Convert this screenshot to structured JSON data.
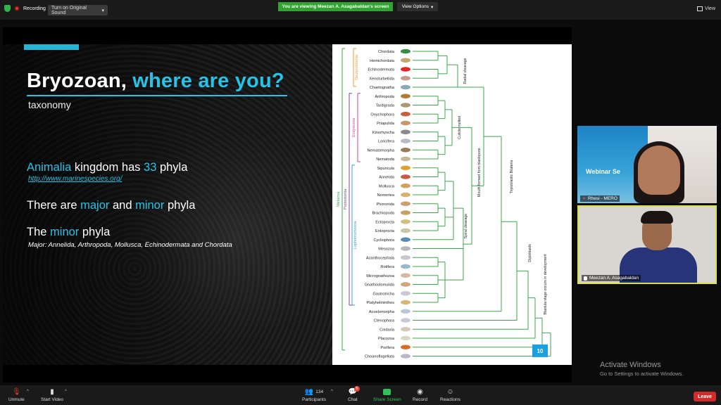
{
  "topbar": {
    "recording_label": "Recording",
    "sound_button": "Turn on Original Sound",
    "viewing_banner": "You are viewing Meezan A. Asagabaldan's screen",
    "view_options": "View Options",
    "view_label": "View"
  },
  "slide": {
    "title_part1": "Bryozoan, ",
    "title_part2": "where are you?",
    "subtitle": "taxonomy",
    "l1_a": "Animalia",
    "l1_b": " kingdom has ",
    "l1_c": "33",
    "l1_d": " phyla",
    "link": "http://www.marinespecies.org/",
    "l2_a": "There are ",
    "l2_b": "major",
    "l2_c": " and ",
    "l2_d": "minor",
    "l2_e": " phyla",
    "l3_a": "The ",
    "l3_b": "minor",
    "l3_c": " phyla",
    "major_note": "Major: Annelida, Arthropoda, Mollusca, Echinodermata and Chordata"
  },
  "tree": {
    "taxa": [
      "Chordata",
      "Hemichordata",
      "Echinodermata",
      "Xenoturbellida",
      "Chaetognatha",
      "Arthropoda",
      "Tardigrada",
      "Onychophora",
      "Priapulida",
      "Kinorhyncha",
      "Loricifera",
      "Nematomorpha",
      "Nematoda",
      "Sipuncula",
      "Annelida",
      "Mollusca",
      "Nemertea",
      "Phoronida",
      "Brachiopoda",
      "Ectoprocta",
      "Entoprocta",
      "Cycliophora",
      "Mesozoa",
      "Acanthocephala",
      "Rotifera",
      "Micrognathozoa",
      "Gnathostomulida",
      "Gastrotricha",
      "Platyhelminthes",
      "Acoelomorpha",
      "Ctenophora",
      "Cnidaria",
      "Placozoa",
      "Porifera",
      "Choanoflagellata"
    ],
    "groups": {
      "deuterostomia": "Deuterostomia",
      "ecdysozoa": "Ecdysozoa",
      "protostomia": "Protostomia",
      "lophotrochozoa": "Lophotrochozoa",
      "metazoa": "Metazoa"
    },
    "node_labels": {
      "radial": "Radial cleavage",
      "cuticle": "Cuticle molted",
      "mouth": "Mouth formed from blastopore",
      "spiral": "Spiral cleavage",
      "triplo": "Triploblastic Bilateria",
      "diplo": "Diploblasts",
      "blastula": "Blastula stage occurs in development"
    },
    "badge": "10",
    "colors": {
      "deuterostomia": "#f29a3a",
      "ecdysozoa": "#d6409a",
      "protostomia": "#8a3fa8",
      "lophotrochozoa": "#3aa0d8",
      "metazoa": "#3aa84a"
    }
  },
  "participants_panel": {
    "p1_name": "Rhesi - MERO",
    "p1_banner": "Webinar Se",
    "p2_name": "Meezan A. Asagabaldan"
  },
  "watermark": {
    "line1": "Activate Windows",
    "line2": "Go to Settings to activate Windows."
  },
  "bottombar": {
    "unmute": "Unmute",
    "start_video": "Start Video",
    "participants": "Participants",
    "participants_count": "134",
    "chat": "Chat",
    "chat_badge": "5",
    "share_screen": "Share Screen",
    "record": "Record",
    "reactions": "Reactions",
    "leave": "Leave"
  }
}
